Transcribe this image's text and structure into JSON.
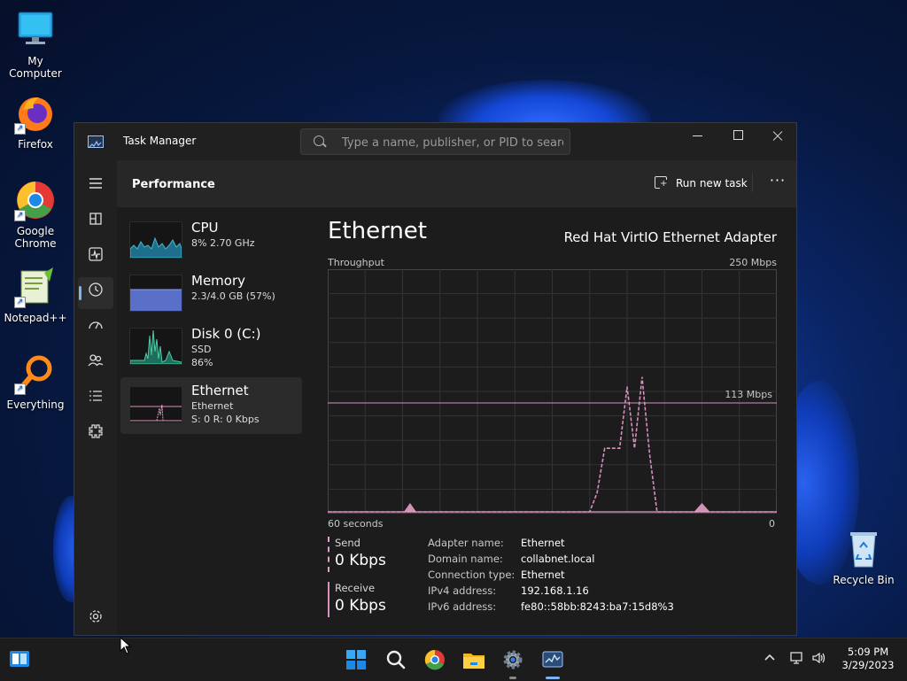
{
  "desktop": {
    "icons": [
      {
        "label": "My Computer"
      },
      {
        "label": "Firefox"
      },
      {
        "label": "Google Chrome"
      },
      {
        "label": "Notepad++"
      },
      {
        "label": "Everything"
      },
      {
        "label": "Recycle Bin"
      }
    ]
  },
  "window": {
    "title": "Task Manager",
    "search_placeholder": "Type a name, publisher, or PID to search",
    "app_icon": "task-manager-icon"
  },
  "nav": {
    "items": [
      {
        "icon": "hamburger-menu-icon"
      },
      {
        "icon": "processes-icon"
      },
      {
        "icon": "performance-icon",
        "active": true
      },
      {
        "icon": "app-history-icon"
      },
      {
        "icon": "startup-apps-icon"
      },
      {
        "icon": "users-icon"
      },
      {
        "icon": "details-icon"
      },
      {
        "icon": "services-icon"
      },
      {
        "icon": "settings-icon"
      }
    ]
  },
  "header": {
    "page_title": "Performance",
    "run_new_task": "Run new task",
    "more": "···"
  },
  "resources": [
    {
      "name": "CPU",
      "line1": "8% 2.70 GHz",
      "line2": "",
      "line3": ""
    },
    {
      "name": "Memory",
      "line1": "2.3/4.0 GB (57%)",
      "line2": "",
      "line3": ""
    },
    {
      "name": "Disk 0 (C:)",
      "line1": "SSD",
      "line2": "86%",
      "line3": ""
    },
    {
      "name": "Ethernet",
      "line1": "Ethernet",
      "line2": "S: 0 R: 0 Kbps",
      "line3": "",
      "active": true
    }
  ],
  "detail": {
    "title": "Ethernet",
    "adapter": "Red Hat VirtIO Ethernet Adapter",
    "throughput_label": "Throughput",
    "max_label": "250 Mbps",
    "marker_label": "113 Mbps",
    "time_label": "60 seconds",
    "zero_label": "0",
    "send_label": "Send",
    "send_value": "0 Kbps",
    "receive_label": "Receive",
    "receive_value": "0 Kbps",
    "info": [
      {
        "key": "Adapter name:",
        "value": "Ethernet"
      },
      {
        "key": "Domain name:",
        "value": "collabnet.local"
      },
      {
        "key": "Connection type:",
        "value": "Ethernet"
      },
      {
        "key": "IPv4 address:",
        "value": "192.168.1.16"
      },
      {
        "key": "IPv6 address:",
        "value": "fe80::58bb:8243:ba7:15d8%3"
      }
    ],
    "colors": {
      "send": "#e6a0c8",
      "receive": "#d98fc0",
      "grid": "#333333"
    }
  },
  "chart_data": {
    "type": "line",
    "xlabel": "60 seconds",
    "ylabel": "Throughput",
    "xlim": [
      60,
      0
    ],
    "ylim": [
      0,
      250
    ],
    "scale_marker": 113,
    "series": [
      {
        "name": "Send",
        "x": [
          60,
          49,
          48,
          47,
          46,
          45,
          44,
          43,
          42,
          41,
          40,
          39,
          38,
          37,
          36,
          35,
          34,
          33,
          32,
          31,
          30,
          29,
          28,
          27,
          26,
          25,
          24,
          23,
          22,
          21,
          20,
          19,
          18,
          17,
          16,
          15,
          14,
          13,
          12,
          11,
          10,
          9,
          8,
          7,
          6,
          5,
          4,
          3,
          2,
          1,
          0
        ],
        "values": [
          0,
          0,
          0,
          0,
          0,
          0,
          0,
          0,
          0,
          0,
          0,
          0,
          0,
          0,
          0,
          0,
          0,
          0,
          0,
          0,
          0,
          0,
          0,
          0,
          0,
          0,
          0,
          0,
          0,
          0,
          0,
          0,
          0,
          0,
          0,
          0,
          0,
          0,
          0,
          0,
          0,
          0,
          0,
          0,
          0,
          0,
          0,
          0,
          0,
          0,
          0
        ]
      },
      {
        "name": "Receive",
        "x": [
          60,
          56,
          48,
          47,
          46,
          45,
          44,
          43,
          42,
          41,
          40,
          39,
          38,
          37,
          36,
          35,
          34,
          33,
          32,
          31,
          30,
          29,
          28,
          27,
          26,
          25,
          24,
          23,
          22,
          21,
          20,
          19,
          18,
          17,
          16,
          15,
          14,
          13,
          12,
          11,
          10,
          9,
          8,
          7,
          6,
          5,
          4,
          3,
          2,
          1,
          0
        ],
        "values": [
          0,
          0,
          0,
          0,
          0,
          0,
          0,
          0,
          0,
          0,
          0,
          0,
          0,
          0,
          0,
          0,
          0,
          0,
          0,
          0,
          0,
          0,
          0,
          0,
          0,
          0,
          20,
          66,
          66,
          66,
          130,
          66,
          140,
          60,
          0,
          0,
          0,
          0,
          0,
          0,
          0,
          0,
          0,
          0,
          0,
          0,
          0,
          0,
          0,
          0,
          0
        ]
      }
    ]
  },
  "taskbar": {
    "apps": [
      {
        "icon": "start-icon"
      },
      {
        "icon": "search-icon"
      },
      {
        "icon": "chrome-icon"
      },
      {
        "icon": "file-explorer-icon"
      },
      {
        "icon": "settings-gear-icon"
      },
      {
        "icon": "task-manager-icon"
      }
    ],
    "time": "5:09 PM",
    "date": "3/29/2023"
  }
}
